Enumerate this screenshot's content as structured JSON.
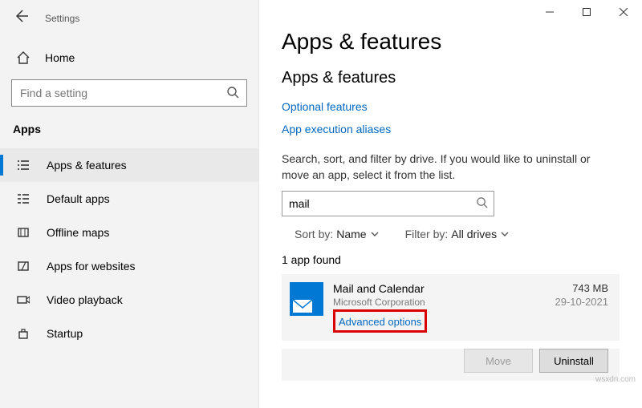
{
  "window": {
    "title": "Settings"
  },
  "sidebar": {
    "home": "Home",
    "search_placeholder": "Find a setting",
    "section": "Apps",
    "items": [
      {
        "label": "Apps & features"
      },
      {
        "label": "Default apps"
      },
      {
        "label": "Offline maps"
      },
      {
        "label": "Apps for websites"
      },
      {
        "label": "Video playback"
      },
      {
        "label": "Startup"
      }
    ]
  },
  "main": {
    "h1": "Apps & features",
    "h2": "Apps & features",
    "link_optional": "Optional features",
    "link_aliases": "App execution aliases",
    "desc": "Search, sort, and filter by drive. If you would like to uninstall or move an app, select it from the list.",
    "search_value": "mail",
    "sort": {
      "label": "Sort by:",
      "value": "Name"
    },
    "filter": {
      "label": "Filter by:",
      "value": "All drives"
    },
    "count": "1 app found",
    "app": {
      "name": "Mail and Calendar",
      "publisher": "Microsoft Corporation",
      "advanced": "Advanced options",
      "size": "743 MB",
      "date": "29-10-2021"
    },
    "buttons": {
      "move": "Move",
      "uninstall": "Uninstall"
    }
  },
  "watermark": "wsxdn.com"
}
